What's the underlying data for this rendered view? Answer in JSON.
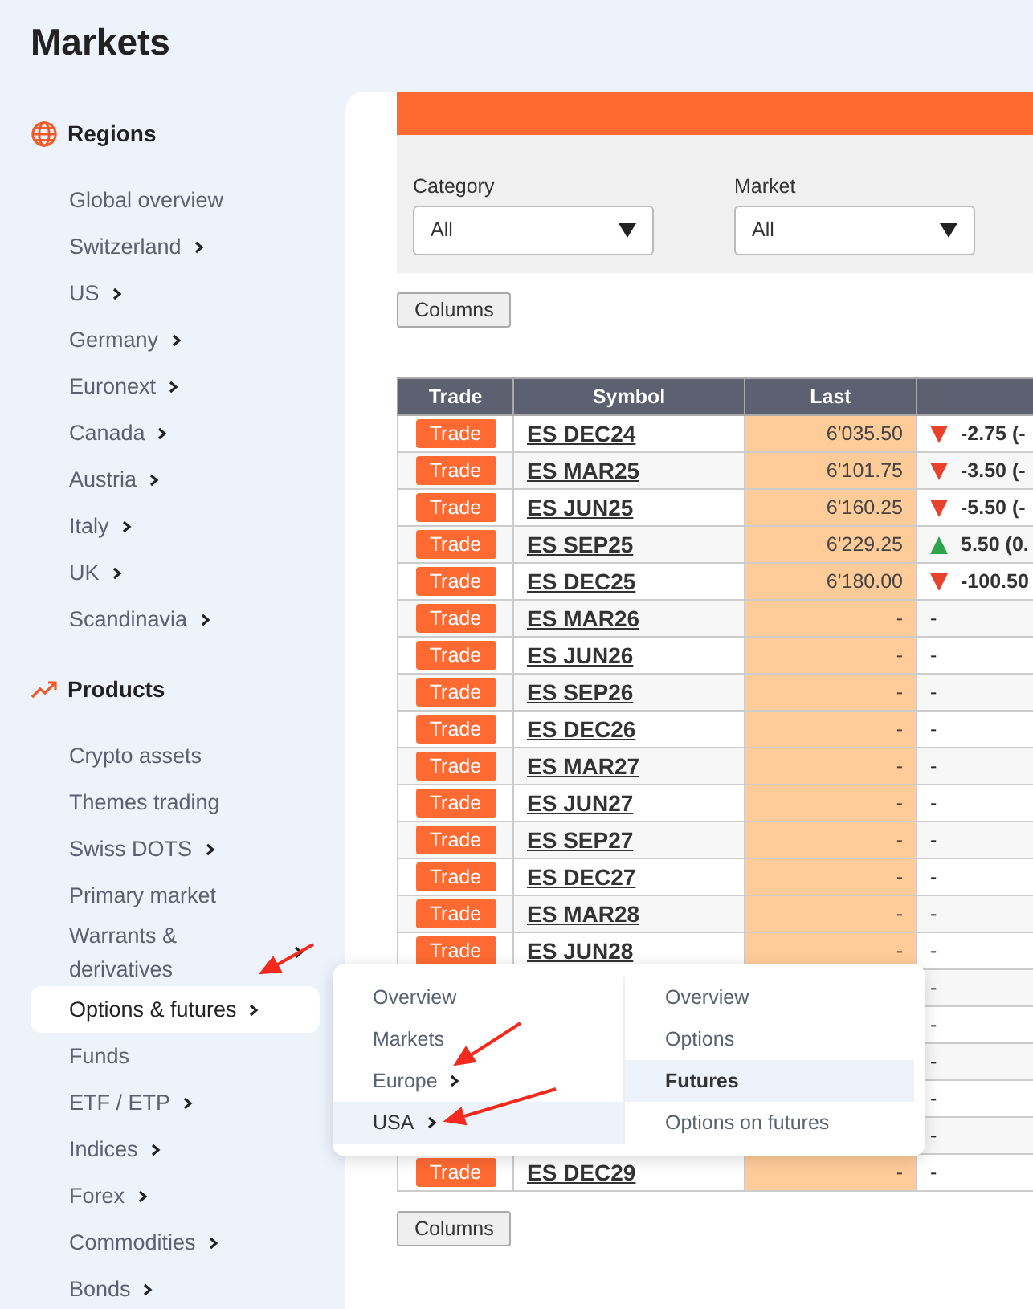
{
  "sidebar": {
    "title": "Markets",
    "sections": [
      {
        "title": "Regions",
        "items": [
          {
            "label": "Global overview",
            "submenu": false,
            "selected": false
          },
          {
            "label": "Switzerland",
            "submenu": true,
            "selected": false
          },
          {
            "label": "US",
            "submenu": true,
            "selected": false
          },
          {
            "label": "Germany",
            "submenu": true,
            "selected": false
          },
          {
            "label": "Euronext",
            "submenu": true,
            "selected": false
          },
          {
            "label": "Canada",
            "submenu": true,
            "selected": false
          },
          {
            "label": "Austria",
            "submenu": true,
            "selected": false
          },
          {
            "label": "Italy",
            "submenu": true,
            "selected": false
          },
          {
            "label": "UK",
            "submenu": true,
            "selected": false
          },
          {
            "label": "Scandinavia",
            "submenu": true,
            "selected": false
          }
        ]
      },
      {
        "title": "Products",
        "items": [
          {
            "label": "Crypto assets",
            "submenu": false,
            "selected": false
          },
          {
            "label": "Themes trading",
            "submenu": false,
            "selected": false
          },
          {
            "label": "Swiss DOTS",
            "submenu": true,
            "selected": false
          },
          {
            "label": "Primary market",
            "submenu": false,
            "selected": false
          },
          {
            "label": "Warrants & derivatives",
            "submenu": true,
            "selected": false
          },
          {
            "label": "Options & futures",
            "submenu": true,
            "selected": true
          },
          {
            "label": "Funds",
            "submenu": false,
            "selected": false
          },
          {
            "label": "ETF / ETP",
            "submenu": true,
            "selected": false
          },
          {
            "label": "Indices",
            "submenu": true,
            "selected": false
          },
          {
            "label": "Forex",
            "submenu": true,
            "selected": false
          },
          {
            "label": "Commodities",
            "submenu": true,
            "selected": false
          },
          {
            "label": "Bonds",
            "submenu": true,
            "selected": false
          }
        ]
      }
    ]
  },
  "filters": [
    {
      "label": "Category",
      "value": "All"
    },
    {
      "label": "Market",
      "value": "All"
    }
  ],
  "columns_button_top": "Columns",
  "table": {
    "columns": [
      "Trade",
      "Symbol",
      "Last"
    ],
    "rows": [
      {
        "trade": "Trade",
        "symbol": "ES DEC24",
        "last": "6'035.50",
        "kind": "down",
        "change": "-2.75 (-"
      },
      {
        "trade": "Trade",
        "symbol": "ES MAR25",
        "last": "6'101.75",
        "kind": "down",
        "change": "-3.50 (-"
      },
      {
        "trade": "Trade",
        "symbol": "ES JUN25",
        "last": "6'160.25",
        "kind": "down",
        "change": "-5.50 (-"
      },
      {
        "trade": "Trade",
        "symbol": "ES SEP25",
        "last": "6'229.25",
        "kind": "up",
        "change": "5.50 (0."
      },
      {
        "trade": "Trade",
        "symbol": "ES DEC25",
        "last": "6'180.00",
        "kind": "down",
        "change": "-100.50"
      },
      {
        "trade": "Trade",
        "symbol": "ES MAR26",
        "last": "-",
        "change": "-"
      },
      {
        "trade": "Trade",
        "symbol": "ES JUN26",
        "last": "-",
        "change": "-"
      },
      {
        "trade": "Trade",
        "symbol": "ES SEP26",
        "last": "-",
        "change": "-"
      },
      {
        "trade": "Trade",
        "symbol": "ES DEC26",
        "last": "-",
        "change": "-"
      },
      {
        "trade": "Trade",
        "symbol": "ES MAR27",
        "last": "-",
        "change": "-"
      },
      {
        "trade": "Trade",
        "symbol": "ES JUN27",
        "last": "-",
        "change": "-"
      },
      {
        "trade": "Trade",
        "symbol": "ES SEP27",
        "last": "-",
        "change": "-"
      },
      {
        "trade": "Trade",
        "symbol": "ES DEC27",
        "last": "-",
        "change": "-"
      },
      {
        "trade": "Trade",
        "symbol": "ES MAR28",
        "last": "-",
        "change": "-"
      },
      {
        "trade": "Trade",
        "symbol": "ES JUN28",
        "last": "-",
        "change": "-"
      },
      {
        "change": "-"
      },
      {
        "change": "-"
      },
      {
        "change": "-"
      },
      {
        "change": "-"
      },
      {
        "change": "-"
      },
      {
        "trade": "Trade",
        "symbol": "ES DEC29",
        "last": "-",
        "change": "-"
      }
    ]
  },
  "columns_button_bottom": "Columns",
  "flyout": {
    "columns": [
      [
        {
          "label": "Overview",
          "submenu": false,
          "selected": false
        },
        {
          "label": "Markets",
          "submenu": false,
          "selected": false
        },
        {
          "label": "Europe",
          "submenu": true,
          "selected": false
        },
        {
          "label": "USA",
          "submenu": true,
          "selected": true
        }
      ],
      [
        {
          "label": "Overview",
          "submenu": false,
          "selected": false
        },
        {
          "label": "Options",
          "submenu": false,
          "selected": false
        },
        {
          "label": "Futures",
          "submenu": false,
          "selected": true
        },
        {
          "label": "Options on futures",
          "submenu": false,
          "selected": false
        }
      ]
    ]
  }
}
